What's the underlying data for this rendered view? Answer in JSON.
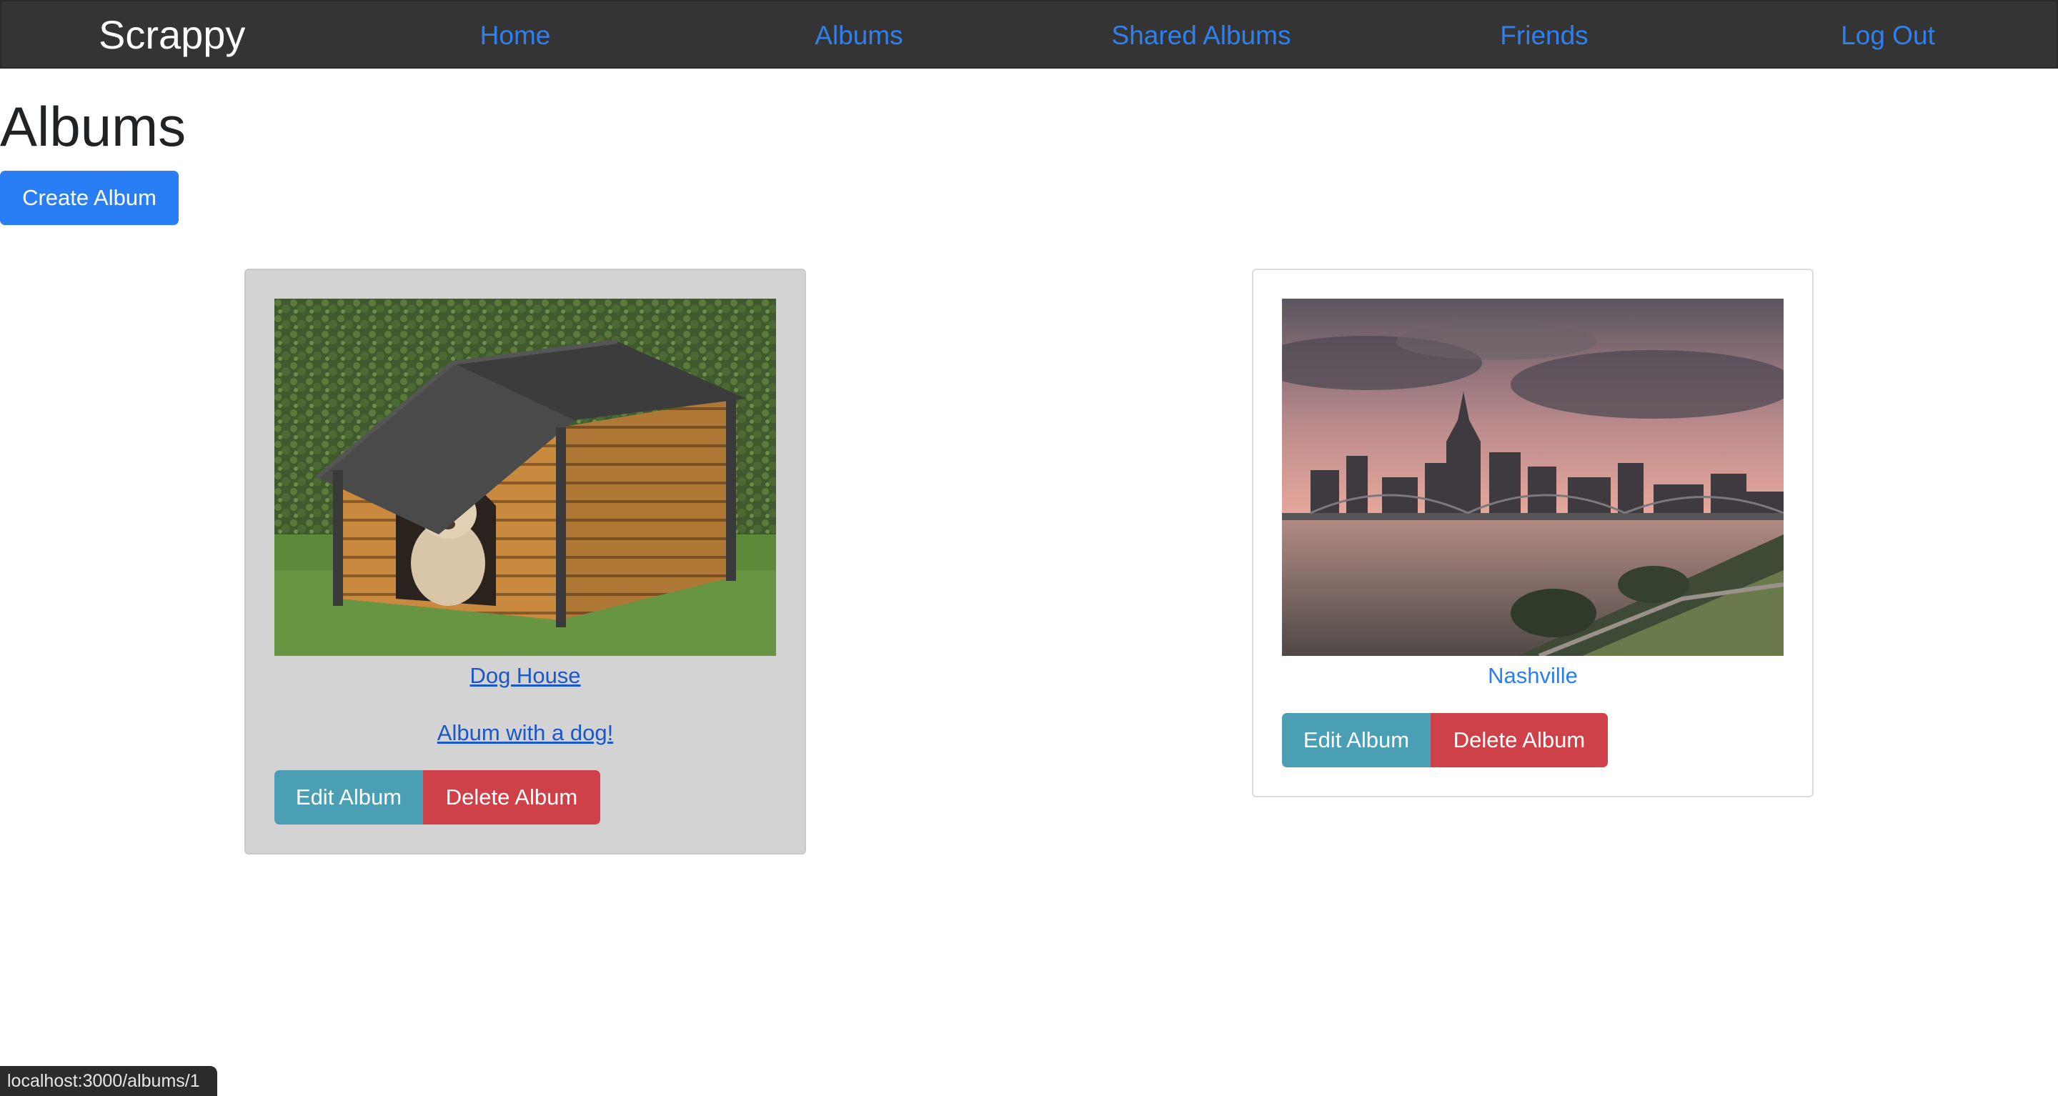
{
  "navbar": {
    "brand": "Scrappy",
    "links": [
      {
        "label": "Home"
      },
      {
        "label": "Albums"
      },
      {
        "label": "Shared Albums"
      },
      {
        "label": "Friends"
      },
      {
        "label": "Log Out"
      }
    ]
  },
  "page": {
    "title": "Albums",
    "create_button": "Create Album"
  },
  "albums": [
    {
      "name": "Dog House",
      "description": "Album with a dog!",
      "edit_label": "Edit Album",
      "delete_label": "Delete Album",
      "image_alt": "Dog sitting in a wooden dog house"
    },
    {
      "name": "Nashville",
      "edit_label": "Edit Album",
      "delete_label": "Delete Album",
      "image_alt": "Nashville skyline at sunset over the river"
    }
  ],
  "status_bar": {
    "url": "localhost:3000/albums/1"
  },
  "colors": {
    "navbar_bg": "#343434",
    "link": "#2f80ed",
    "primary": "#2a7ef5",
    "info": "#4a9fb5",
    "danger": "#cf4149",
    "hover_card": "#d3d3d3"
  }
}
